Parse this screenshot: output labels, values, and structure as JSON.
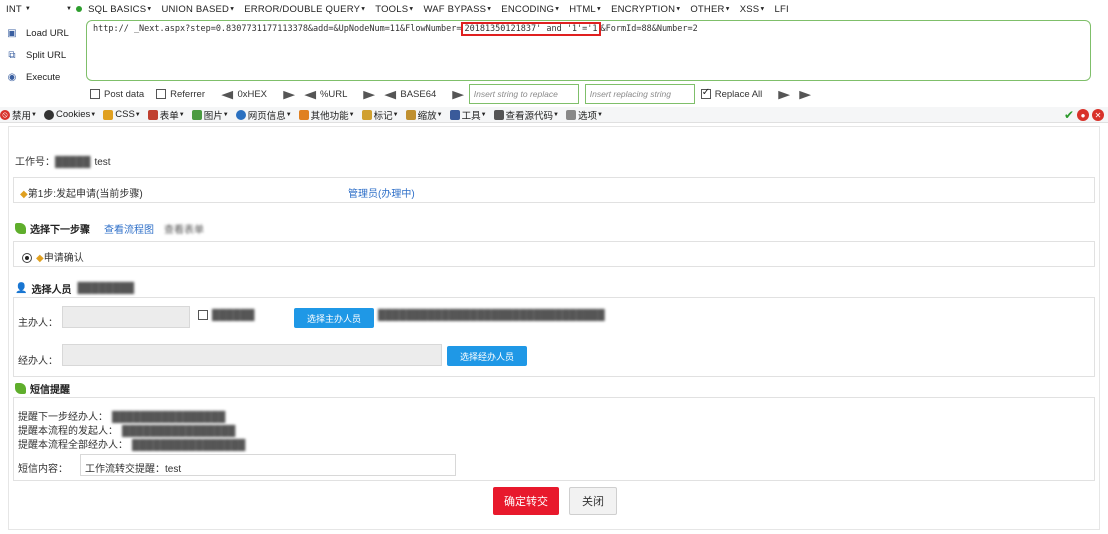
{
  "hackbar": {
    "selector": "INT",
    "menu": [
      "SQL BASICS",
      "UNION BASED",
      "ERROR/DOUBLE QUERY",
      "TOOLS",
      "WAF BYPASS",
      "ENCODING",
      "HTML",
      "ENCRYPTION",
      "OTHER",
      "XSS",
      "LFI"
    ],
    "side": {
      "load_url": "Load URL",
      "split_url": "Split URL",
      "execute": "Execute"
    },
    "url_before": "http://                                                  _Next.aspx?step=0.8307731177113378&add=&UpNodeNum=11&FlowNumber=",
    "url_injected": "20181350121837' and '1'='1",
    "url_after": "&FormId=88&Number=2",
    "options": {
      "post_data": "Post data",
      "referrer": "Referrer",
      "hex": "0xHEX",
      "url": "%URL",
      "base64": "BASE64",
      "insert_placeholder": "Insert string to replace",
      "replacing_placeholder": "Insert replacing string",
      "replace_all": "Replace All"
    }
  },
  "toolbar": {
    "items": [
      "禁用",
      "Cookies",
      "CSS",
      "表单",
      "图片",
      "网页信息",
      "其他功能",
      "标记",
      "缩放",
      "工具",
      "查看源代码",
      "选项"
    ]
  },
  "page": {
    "work_no_label": "工作号：",
    "work_no_value": "test",
    "step_text": "第1步:发起申请(当前步骤)",
    "admin_text": "管理员(办理中)",
    "next_step_title": "选择下一步骤",
    "view_flowchart": "查看流程图",
    "view_form": "查看表单",
    "apply_confirm": "申请确认",
    "select_person_title": "选择人员",
    "main_handler_label": "主办人：",
    "select_main_btn": "选择主办人员",
    "co_handler_label": "经办人：",
    "select_co_btn": "选择经办人员",
    "reminder_title": "短信提醒",
    "remind_next": "提醒下一步经办人：",
    "remind_initiator": "提醒本流程的发起人：",
    "remind_all": "提醒本流程全部经办人：",
    "sms_label": "短信内容：",
    "sms_value": "工作流转交提醒：test",
    "confirm_btn": "确定转交",
    "close_btn": "关闭"
  }
}
